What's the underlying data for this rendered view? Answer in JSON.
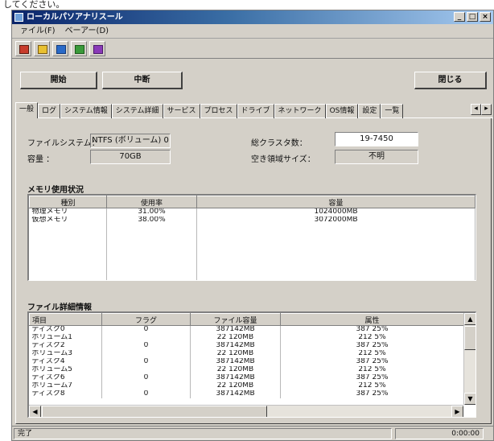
{
  "caption": "してください。",
  "window": {
    "title": "ローカルパソアナリスール",
    "buttons": [
      "_",
      "□",
      "×"
    ]
  },
  "menu": [
    "ァイル(F)",
    "ベーアー(D)"
  ],
  "buttons": {
    "start": "開始",
    "stop": "中断",
    "close": "閉じる"
  },
  "tabs": [
    "一般",
    "ログ",
    "システム情報",
    "システム詳細",
    "サービス",
    "プロセス",
    "ドライブ",
    "ネットワーク",
    "OS情報",
    "設定",
    "一覧"
  ],
  "general": {
    "fs_label": "ファイルシステム：",
    "fs_value": "NTFS (ボリューム) 0",
    "size_label": "容量 ：",
    "size_value": "70GB",
    "clusters_label": "総クラスタ数：",
    "clusters_value": "19-7450",
    "free_label": "空き領域サイズ：",
    "free_value": "不明"
  },
  "system_section": "メモリ使用状況",
  "system_table": {
    "headers": [
      "種別",
      "使用率",
      "容量"
    ],
    "rows": [
      [
        "物理メモリ",
        "31.00%",
        "1024000MB"
      ],
      [
        "仮想メモリ",
        "38.00%",
        "3072000MB"
      ],
      [
        "",
        "",
        ""
      ],
      [
        "",
        "",
        ""
      ],
      [
        "",
        "",
        ""
      ],
      [
        "",
        "",
        ""
      ],
      [
        "",
        "",
        ""
      ],
      [
        "",
        "",
        ""
      ],
      [
        "",
        "",
        ""
      ]
    ]
  },
  "file_section": "ファイル詳細情報",
  "file_table": {
    "headers": [
      "項目",
      "フラグ",
      "ファイル容量",
      "属性"
    ],
    "rows": [
      [
        "ディスク0",
        "0",
        "387142MB",
        "387 25%"
      ],
      [
        "ボリューム1",
        "",
        "22 120MB",
        "212 5%"
      ],
      [
        "ディスク2",
        "0",
        "387142MB",
        "387 25%"
      ],
      [
        "ボリューム3",
        "",
        "22 120MB",
        "212 5%"
      ],
      [
        "ディスク4",
        "0",
        "387142MB",
        "387 25%"
      ],
      [
        "ボリューム5",
        "",
        "22 120MB",
        "212 5%"
      ],
      [
        "ディスク6",
        "0",
        "387142MB",
        "387 25%"
      ],
      [
        "ボリューム7",
        "",
        "22 120MB",
        "212 5%"
      ],
      [
        "ディスク8",
        "0",
        "387142MB",
        "387 25%"
      ]
    ]
  },
  "status": {
    "left": "完了",
    "right": "0:00:00"
  }
}
